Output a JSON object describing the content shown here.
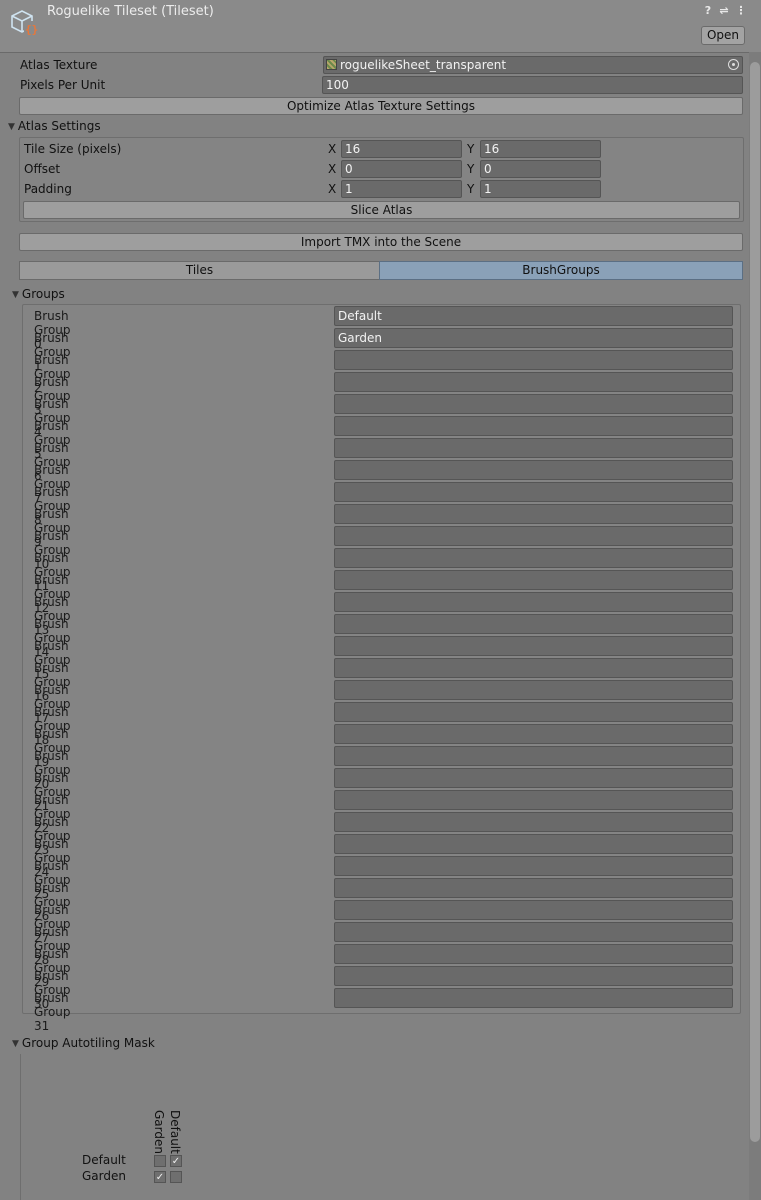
{
  "header": {
    "title": "Roguelike Tileset (Tileset)",
    "open_label": "Open",
    "help_icon": "?",
    "settings_icon": "⇌",
    "menu_icon": "⋮"
  },
  "atlas": {
    "texture_label": "Atlas Texture",
    "texture_value": "roguelikeSheet_transparent",
    "ppu_label": "Pixels Per Unit",
    "ppu_value": "100",
    "optimize_label": "Optimize Atlas Texture Settings"
  },
  "atlas_settings": {
    "title": "Atlas Settings",
    "tile_size_label": "Tile Size (pixels)",
    "tile_size_x": "16",
    "tile_size_y": "16",
    "offset_label": "Offset",
    "offset_x": "0",
    "offset_y": "0",
    "padding_label": "Padding",
    "padding_x": "1",
    "padding_y": "1",
    "x": "X",
    "y": "Y",
    "slice_label": "Slice Atlas"
  },
  "import_label": "Import TMX into the Scene",
  "tabs": {
    "tiles": "Tiles",
    "brush_groups": "BrushGroups"
  },
  "groups": {
    "title": "Groups",
    "items": [
      {
        "label": "Brush Group 0",
        "value": "Default"
      },
      {
        "label": "Brush Group 1",
        "value": "Garden"
      },
      {
        "label": "Brush Group 2",
        "value": ""
      },
      {
        "label": "Brush Group 3",
        "value": ""
      },
      {
        "label": "Brush Group 4",
        "value": ""
      },
      {
        "label": "Brush Group 5",
        "value": ""
      },
      {
        "label": "Brush Group 6",
        "value": ""
      },
      {
        "label": "Brush Group 7",
        "value": ""
      },
      {
        "label": "Brush Group 8",
        "value": ""
      },
      {
        "label": "Brush Group 9",
        "value": ""
      },
      {
        "label": "Brush Group 10",
        "value": ""
      },
      {
        "label": "Brush Group 11",
        "value": ""
      },
      {
        "label": "Brush Group 12",
        "value": ""
      },
      {
        "label": "Brush Group 13",
        "value": ""
      },
      {
        "label": "Brush Group 14",
        "value": ""
      },
      {
        "label": "Brush Group 15",
        "value": ""
      },
      {
        "label": "Brush Group 16",
        "value": ""
      },
      {
        "label": "Brush Group 17",
        "value": ""
      },
      {
        "label": "Brush Group 18",
        "value": ""
      },
      {
        "label": "Brush Group 19",
        "value": ""
      },
      {
        "label": "Brush Group 20",
        "value": ""
      },
      {
        "label": "Brush Group 21",
        "value": ""
      },
      {
        "label": "Brush Group 22",
        "value": ""
      },
      {
        "label": "Brush Group 23",
        "value": ""
      },
      {
        "label": "Brush Group 24",
        "value": ""
      },
      {
        "label": "Brush Group 25",
        "value": ""
      },
      {
        "label": "Brush Group 26",
        "value": ""
      },
      {
        "label": "Brush Group 27",
        "value": ""
      },
      {
        "label": "Brush Group 28",
        "value": ""
      },
      {
        "label": "Brush Group 29",
        "value": ""
      },
      {
        "label": "Brush Group 30",
        "value": ""
      },
      {
        "label": "Brush Group 31",
        "value": ""
      }
    ]
  },
  "autotiling": {
    "title": "Group Autotiling Mask",
    "col_garden": "Garden",
    "col_default": "Default",
    "row_default": "Default",
    "row_garden": "Garden",
    "check_mark": "✓",
    "matrix": [
      [
        false,
        true
      ],
      [
        true,
        false
      ]
    ]
  }
}
